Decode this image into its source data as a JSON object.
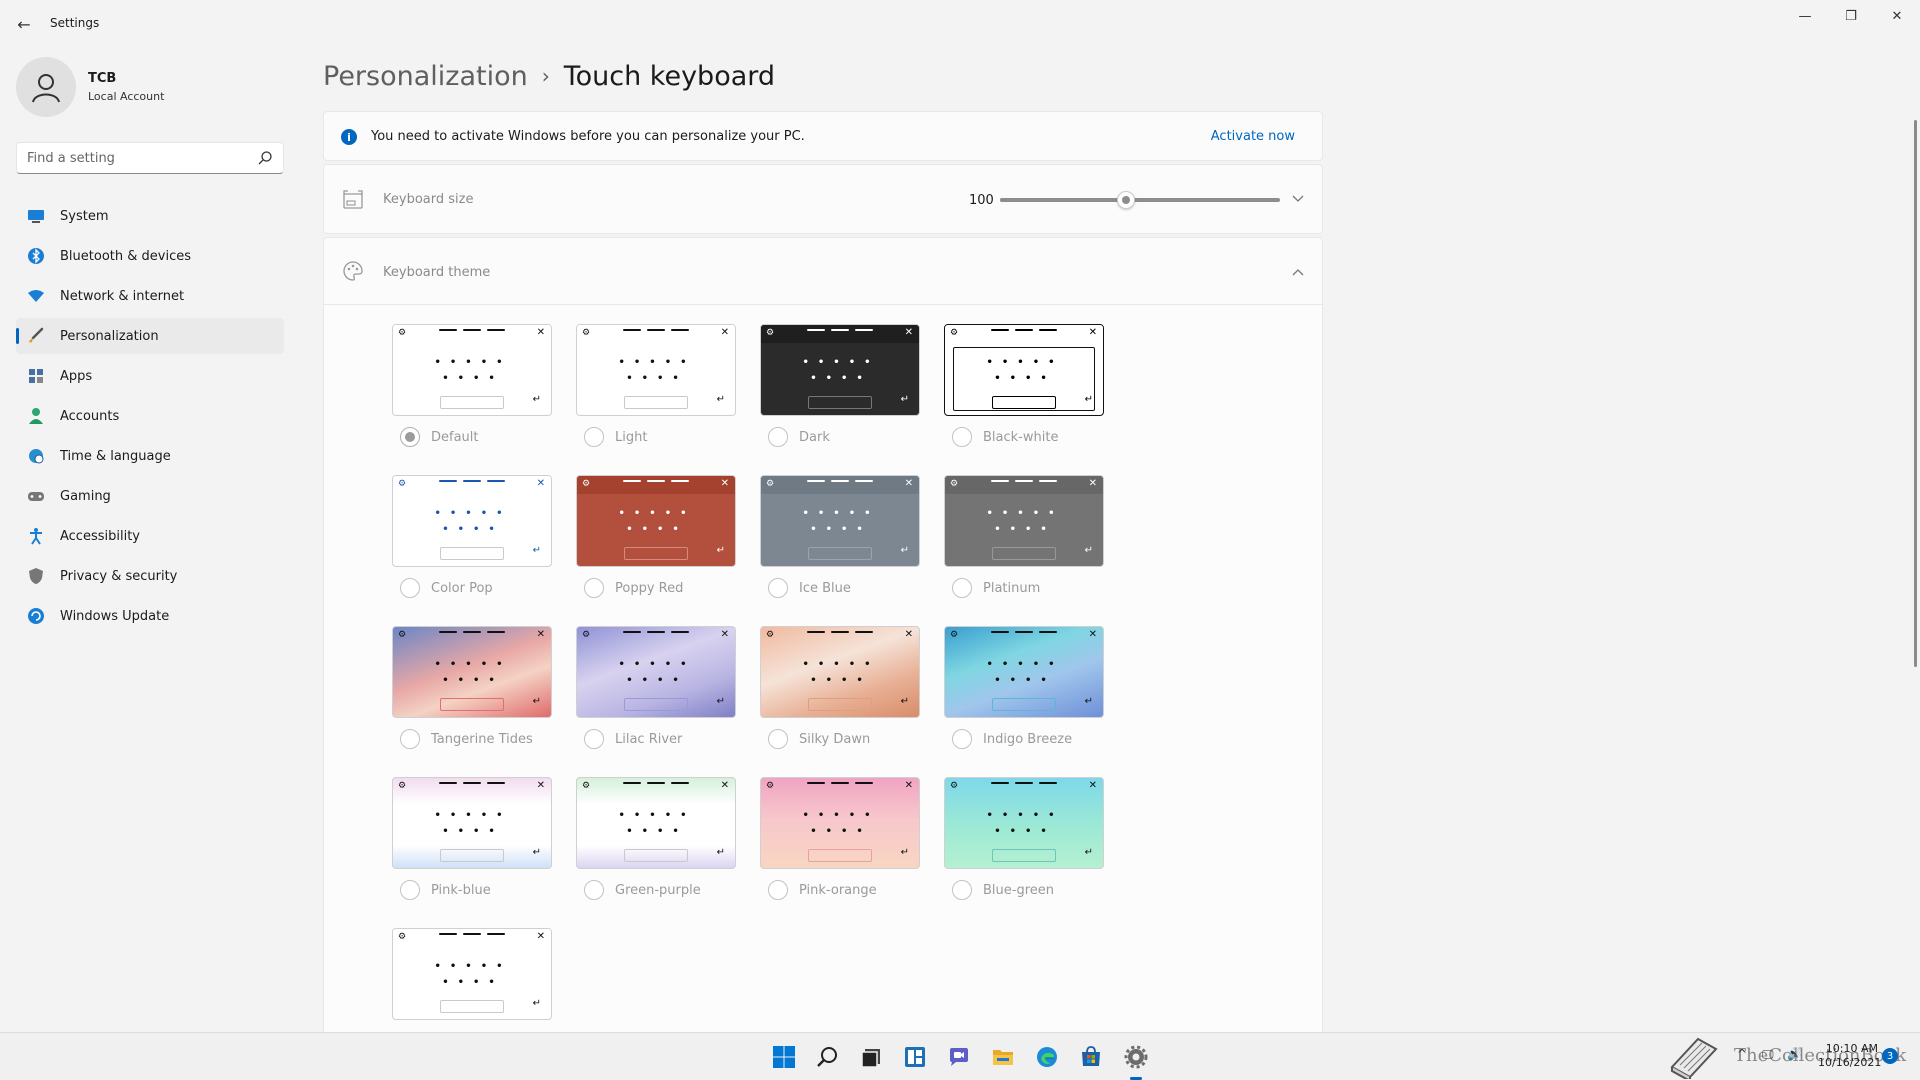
{
  "window": {
    "title": "Settings",
    "minimize_glyph": "—",
    "restore_glyph": "❐",
    "close_glyph": "✕",
    "back_glyph": "←"
  },
  "profile": {
    "name": "TCB",
    "account_type": "Local Account"
  },
  "search": {
    "placeholder": "Find a setting",
    "value": ""
  },
  "nav": {
    "items": [
      {
        "label": "System",
        "icon": "monitor-icon"
      },
      {
        "label": "Bluetooth & devices",
        "icon": "bluetooth-icon"
      },
      {
        "label": "Network & internet",
        "icon": "wifi-icon"
      },
      {
        "label": "Personalization",
        "icon": "brush-icon",
        "active": true
      },
      {
        "label": "Apps",
        "icon": "apps-icon"
      },
      {
        "label": "Accounts",
        "icon": "person-icon"
      },
      {
        "label": "Time & language",
        "icon": "globe-clock-icon"
      },
      {
        "label": "Gaming",
        "icon": "gamepad-icon"
      },
      {
        "label": "Accessibility",
        "icon": "accessibility-icon"
      },
      {
        "label": "Privacy & security",
        "icon": "shield-icon"
      },
      {
        "label": "Windows Update",
        "icon": "update-icon"
      }
    ]
  },
  "header": {
    "parent": "Personalization",
    "separator": "›",
    "current": "Touch keyboard"
  },
  "activation": {
    "icon_glyph": "i",
    "message": "You need to activate Windows before you can personalize your PC.",
    "link": "Activate now"
  },
  "keyboard_size": {
    "label": "Keyboard size",
    "value": "100",
    "slider_fraction": 0.45
  },
  "keyboard_theme": {
    "label": "Keyboard theme",
    "selected": "Default",
    "themes": [
      {
        "name": "Default",
        "checked": true
      },
      {
        "name": "Light"
      },
      {
        "name": "Dark"
      },
      {
        "name": "Black-white"
      },
      {
        "name": "Color Pop"
      },
      {
        "name": "Poppy Red"
      },
      {
        "name": "Ice Blue"
      },
      {
        "name": "Platinum"
      },
      {
        "name": "Tangerine Tides"
      },
      {
        "name": "Lilac River"
      },
      {
        "name": "Silky Dawn"
      },
      {
        "name": "Indigo Breeze"
      },
      {
        "name": "Pink-blue"
      },
      {
        "name": "Green-purple"
      },
      {
        "name": "Pink-orange"
      },
      {
        "name": "Blue-green"
      }
    ]
  },
  "preview_glyphs": {
    "gear": "⚙",
    "close": "✕",
    "dots_row1": "•••••",
    "dots_row2": "••••",
    "enter": "↵"
  },
  "colors": {
    "accent": "#0067c0",
    "window_bg": "#f3f3f3",
    "card_bg": "#fbfbfb"
  },
  "taskbar": {
    "icons": [
      "start-icon",
      "search-icon",
      "task-view-icon",
      "widgets-icon",
      "chat-icon",
      "file-explorer-icon",
      "edge-icon",
      "store-icon",
      "settings-icon"
    ],
    "tray": {
      "chevron": "^",
      "network": "🖵",
      "volume": "🔊"
    },
    "time": "10:10 AM",
    "date": "10/16/2021",
    "notification_count": "3",
    "watermark": "TheCollectionBook"
  }
}
